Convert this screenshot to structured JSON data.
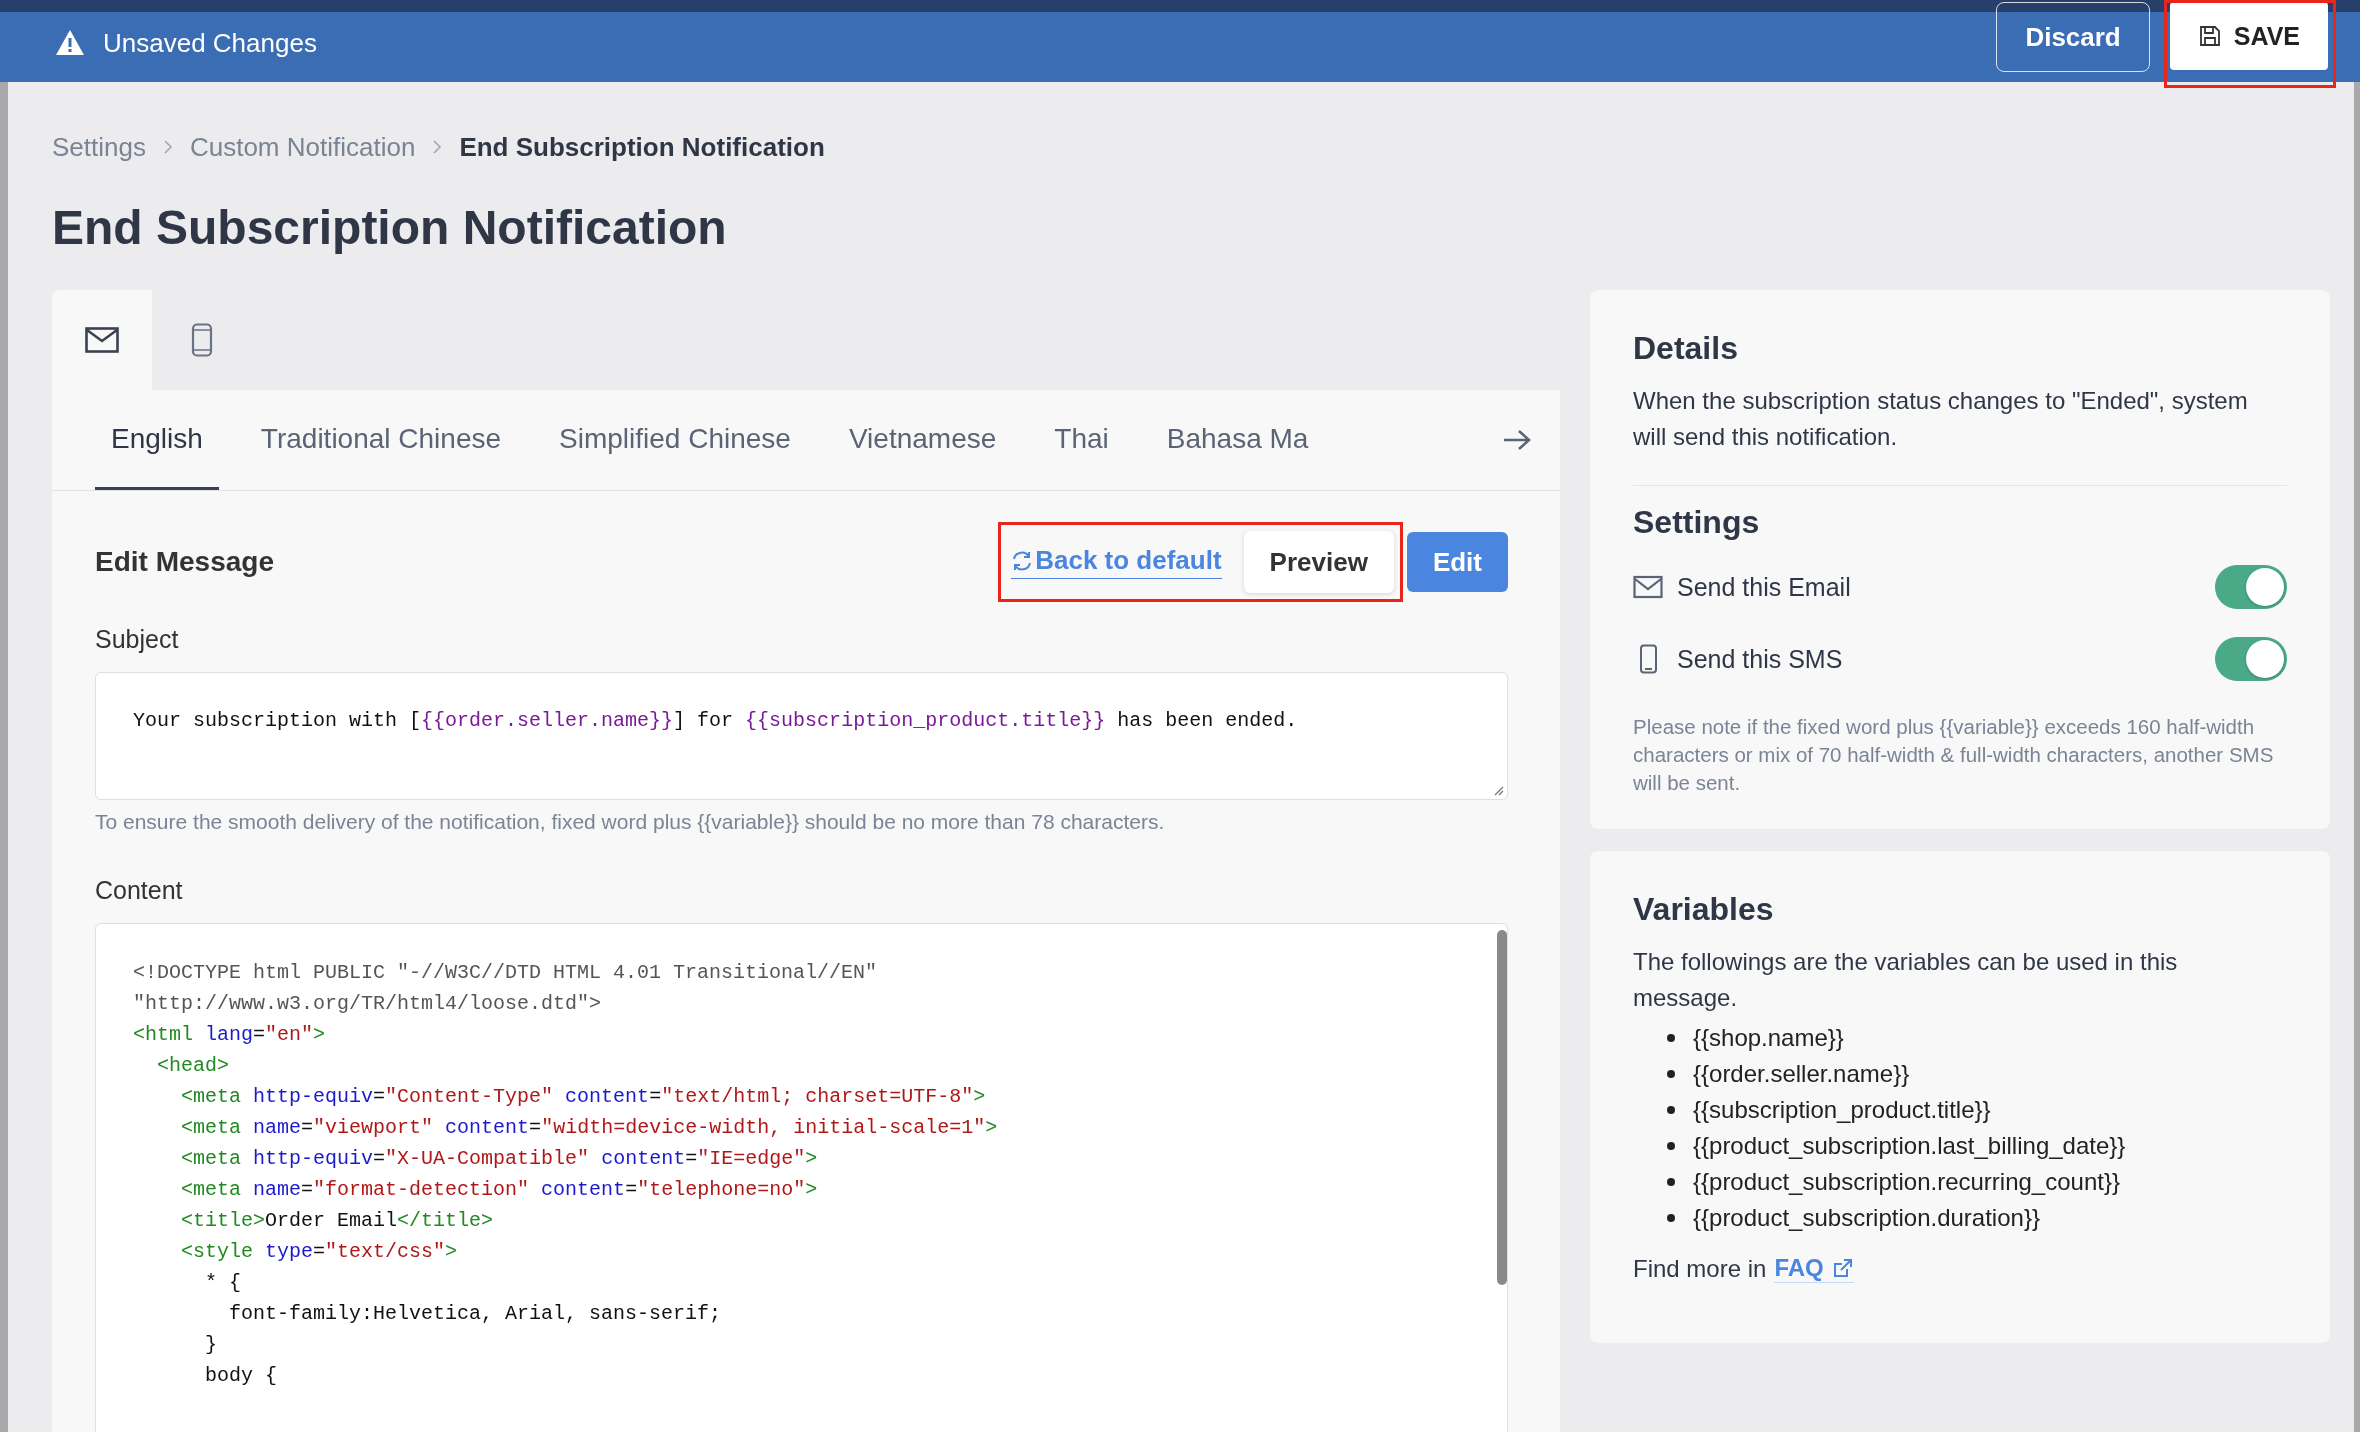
{
  "top_bar": {
    "warning_text": "Unsaved Changes",
    "discard_button": "Discard",
    "save_button": {
      "label": "SAVE",
      "highlighted": true
    }
  },
  "breadcrumb": [
    {
      "label": "Settings",
      "current": false
    },
    {
      "label": "Custom Notification",
      "current": false
    },
    {
      "label": "End Subscription Notification",
      "current": true
    }
  ],
  "page_title": "End Subscription Notification",
  "channel_tabs": [
    {
      "kind": "email",
      "selected": true
    },
    {
      "kind": "sms",
      "selected": false
    }
  ],
  "language_tabs": [
    {
      "label": "English",
      "selected": true
    },
    {
      "label": "Traditional Chinese",
      "selected": false
    },
    {
      "label": "Simplified Chinese",
      "selected": false
    },
    {
      "label": "Vietnamese",
      "selected": false
    },
    {
      "label": "Thai",
      "selected": false
    },
    {
      "label": "Bahasa Ma",
      "selected": false
    }
  ],
  "edit_message": {
    "title": "Edit Message",
    "actions_highlighted": true,
    "back_to_default": "Back to default",
    "preview_button": "Preview",
    "edit_button": "Edit"
  },
  "subject": {
    "label": "Subject",
    "value": [
      {
        "kind": "text",
        "text": "Your subscription with ["
      },
      {
        "kind": "variable",
        "text": "{{order.seller.name}}"
      },
      {
        "kind": "text",
        "text": "] for "
      },
      {
        "kind": "variable",
        "text": "{{subscription_product.title}}"
      },
      {
        "kind": "text",
        "text": " has been ended."
      }
    ],
    "hint": "To ensure the smooth delivery of the notification, fixed word plus {{variable}} should be no more than 78 characters."
  },
  "content": {
    "label": "Content",
    "lines": [
      {
        "tokens": [
          {
            "kind": "doctype",
            "text": "<!DOCTYPE html PUBLIC \"-//W3C//DTD HTML 4.01 Transitional//EN\""
          }
        ]
      },
      {
        "tokens": [
          {
            "kind": "doctype",
            "text": "\"http://www.w3.org/TR/html4/loose.dtd\">"
          }
        ]
      },
      {
        "tokens": [
          {
            "kind": "tag",
            "text": "<html"
          },
          {
            "kind": "attr",
            "text": " lang"
          },
          {
            "kind": "text",
            "text": "="
          },
          {
            "kind": "value",
            "text": "\"en\""
          },
          {
            "kind": "tag",
            "text": ">"
          }
        ]
      },
      {
        "tokens": [
          {
            "kind": "tag",
            "text": "  <head>"
          }
        ]
      },
      {
        "tokens": [
          {
            "kind": "tag",
            "text": "    <meta"
          },
          {
            "kind": "attr",
            "text": " http-equiv"
          },
          {
            "kind": "text",
            "text": "="
          },
          {
            "kind": "value",
            "text": "\"Content-Type\""
          },
          {
            "kind": "attr",
            "text": " content"
          },
          {
            "kind": "text",
            "text": "="
          },
          {
            "kind": "value",
            "text": "\"text/html; charset=UTF-8\""
          },
          {
            "kind": "tag",
            "text": ">"
          }
        ]
      },
      {
        "tokens": [
          {
            "kind": "tag",
            "text": "    <meta"
          },
          {
            "kind": "attr",
            "text": " name"
          },
          {
            "kind": "text",
            "text": "="
          },
          {
            "kind": "value",
            "text": "\"viewport\""
          },
          {
            "kind": "attr",
            "text": " content"
          },
          {
            "kind": "text",
            "text": "="
          },
          {
            "kind": "value",
            "text": "\"width=device-width, initial-scale=1\""
          },
          {
            "kind": "tag",
            "text": ">"
          }
        ]
      },
      {
        "tokens": [
          {
            "kind": "tag",
            "text": "    <meta"
          },
          {
            "kind": "attr",
            "text": " http-equiv"
          },
          {
            "kind": "text",
            "text": "="
          },
          {
            "kind": "value",
            "text": "\"X-UA-Compatible\""
          },
          {
            "kind": "attr",
            "text": " content"
          },
          {
            "kind": "text",
            "text": "="
          },
          {
            "kind": "value",
            "text": "\"IE=edge\""
          },
          {
            "kind": "tag",
            "text": ">"
          }
        ]
      },
      {
        "tokens": [
          {
            "kind": "tag",
            "text": "    <meta"
          },
          {
            "kind": "attr",
            "text": " name"
          },
          {
            "kind": "text",
            "text": "="
          },
          {
            "kind": "value",
            "text": "\"format-detection\""
          },
          {
            "kind": "attr",
            "text": " content"
          },
          {
            "kind": "text",
            "text": "="
          },
          {
            "kind": "value",
            "text": "\"telephone=no\""
          },
          {
            "kind": "tag",
            "text": ">"
          }
        ]
      },
      {
        "tokens": [
          {
            "kind": "tag",
            "text": "    <title>"
          },
          {
            "kind": "text",
            "text": "Order Email"
          },
          {
            "kind": "tag",
            "text": "</title>"
          }
        ]
      },
      {
        "tokens": [
          {
            "kind": "tag",
            "text": "    <style"
          },
          {
            "kind": "attr",
            "text": " type"
          },
          {
            "kind": "text",
            "text": "="
          },
          {
            "kind": "value",
            "text": "\"text/css\""
          },
          {
            "kind": "tag",
            "text": ">"
          }
        ]
      },
      {
        "tokens": [
          {
            "kind": "text",
            "text": "      * {"
          }
        ]
      },
      {
        "tokens": [
          {
            "kind": "text",
            "text": "        font-family:Helvetica, Arial, sans-serif;"
          }
        ]
      },
      {
        "tokens": [
          {
            "kind": "text",
            "text": "      }"
          }
        ]
      },
      {
        "tokens": [
          {
            "kind": "text",
            "text": "      body {"
          }
        ]
      }
    ]
  },
  "details": {
    "title": "Details",
    "description": "When the subscription status changes to \"Ended\", system will send this notification."
  },
  "settings": {
    "title": "Settings",
    "items": [
      {
        "kind": "email",
        "label": "Send this Email",
        "on": true
      },
      {
        "kind": "sms",
        "label": "Send this SMS",
        "on": true
      }
    ],
    "note": "Please note if the fixed word plus {{variable}} exceeds 160 half-width characters or mix of 70 half-width & full-width characters, another SMS will be sent."
  },
  "variables": {
    "title": "Variables",
    "description": "The followings are the variables can be used in this message.",
    "items": [
      "{{shop.name}}",
      "{{order.seller.name}}",
      "{{subscription_product.title}}",
      "{{product_subscription.last_billing_date}}",
      "{{product_subscription.recurring_count}}",
      "{{product_subscription.duration}}"
    ],
    "faq_prefix": "Find more in",
    "faq_link": "FAQ"
  }
}
